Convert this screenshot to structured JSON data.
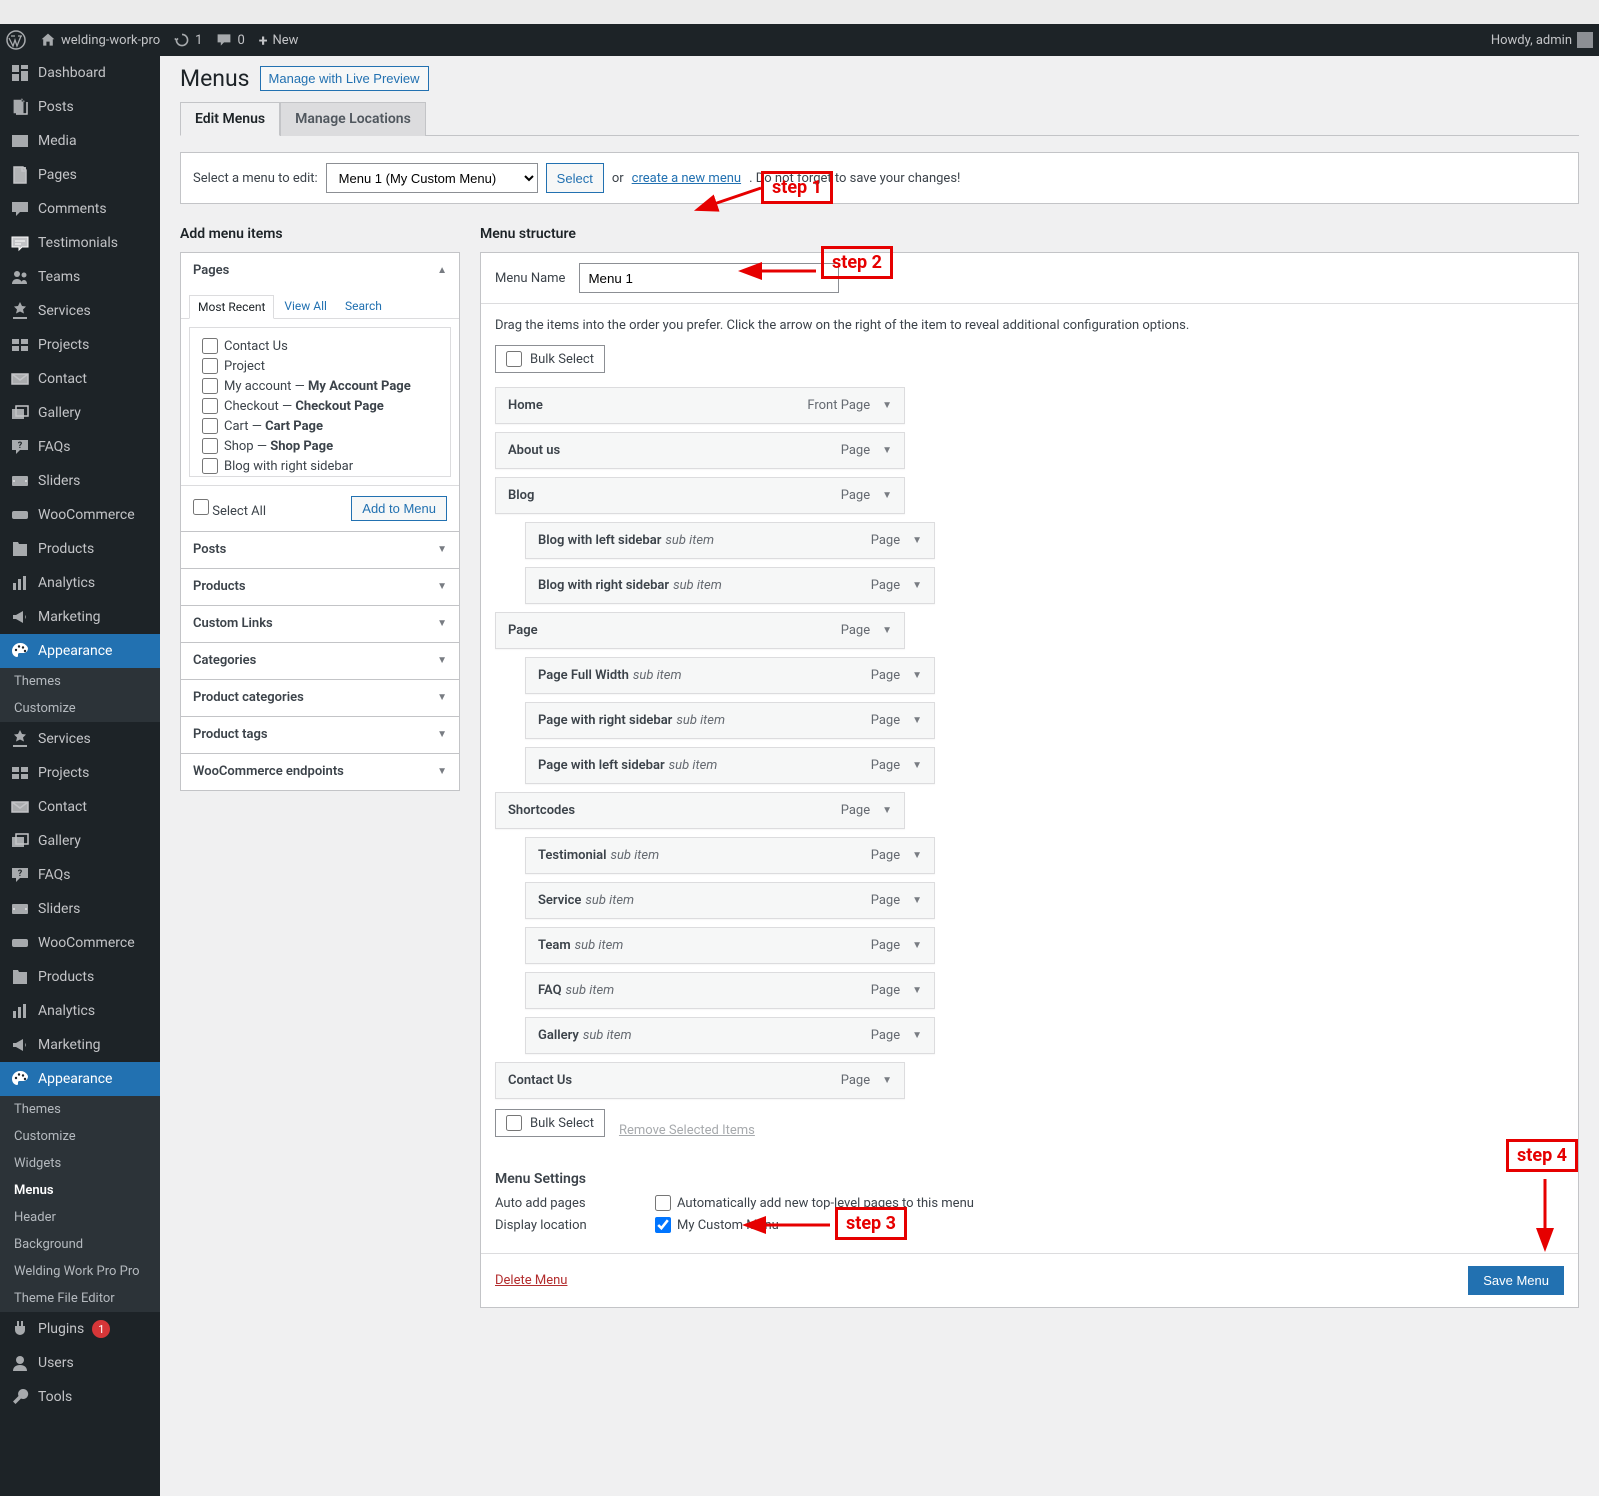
{
  "adminbar": {
    "site_name": "welding-work-pro",
    "updates_count": "1",
    "comments_count": "0",
    "new_label": "New",
    "howdy": "Howdy, admin"
  },
  "sidebar": {
    "items": [
      {
        "icon": "dashboard",
        "label": "Dashboard"
      },
      {
        "icon": "posts",
        "label": "Posts"
      },
      {
        "icon": "media",
        "label": "Media"
      },
      {
        "icon": "pages",
        "label": "Pages"
      },
      {
        "icon": "comments",
        "label": "Comments"
      },
      {
        "icon": "testimonials",
        "label": "Testimonials"
      },
      {
        "icon": "teams",
        "label": "Teams"
      },
      {
        "icon": "services",
        "label": "Services"
      },
      {
        "icon": "projects",
        "label": "Projects"
      },
      {
        "icon": "contact",
        "label": "Contact"
      },
      {
        "icon": "gallery",
        "label": "Gallery"
      },
      {
        "icon": "faqs",
        "label": "FAQs"
      },
      {
        "icon": "sliders",
        "label": "Sliders"
      },
      {
        "icon": "woo",
        "label": "WooCommerce"
      },
      {
        "icon": "products",
        "label": "Products"
      },
      {
        "icon": "analytics",
        "label": "Analytics"
      },
      {
        "icon": "marketing",
        "label": "Marketing"
      },
      {
        "icon": "appearance",
        "label": "Appearance",
        "current": true,
        "sub": [
          "Themes",
          "Customize"
        ]
      },
      {
        "icon": "services",
        "label": "Services"
      },
      {
        "icon": "projects",
        "label": "Projects"
      },
      {
        "icon": "contact",
        "label": "Contact"
      },
      {
        "icon": "gallery",
        "label": "Gallery"
      },
      {
        "icon": "faqs",
        "label": "FAQs"
      },
      {
        "icon": "sliders",
        "label": "Sliders"
      },
      {
        "icon": "woo",
        "label": "WooCommerce"
      },
      {
        "icon": "products",
        "label": "Products"
      },
      {
        "icon": "analytics",
        "label": "Analytics"
      },
      {
        "icon": "marketing",
        "label": "Marketing"
      },
      {
        "icon": "appearance",
        "label": "Appearance",
        "current": true,
        "sub": [
          "Themes",
          "Customize",
          "Widgets",
          "Menus",
          "Header",
          "Background",
          "Welding Work Pro Pro",
          "Theme File Editor"
        ],
        "sub_active": "Menus"
      },
      {
        "icon": "plugins",
        "label": "Plugins",
        "badge": "1"
      },
      {
        "icon": "users",
        "label": "Users"
      },
      {
        "icon": "tools",
        "label": "Tools"
      }
    ]
  },
  "page": {
    "title": "Menus",
    "live_preview": "Manage with Live Preview",
    "tabs": [
      "Edit Menus",
      "Manage Locations"
    ],
    "select_prompt": "Select a menu to edit:",
    "select_value": "Menu 1 (My Custom Menu)",
    "select_btn": "Select",
    "or": "or",
    "create_link": "create a new menu",
    "save_reminder": ". Do not forget to save your changes!"
  },
  "add_items": {
    "heading": "Add menu items",
    "sections": [
      {
        "label": "Pages",
        "open": true
      },
      {
        "label": "Posts"
      },
      {
        "label": "Products"
      },
      {
        "label": "Custom Links"
      },
      {
        "label": "Categories"
      },
      {
        "label": "Product categories"
      },
      {
        "label": "Product tags"
      },
      {
        "label": "WooCommerce endpoints"
      }
    ],
    "subtabs": [
      "Most Recent",
      "View All",
      "Search"
    ],
    "page_list": [
      {
        "label": "Contact Us"
      },
      {
        "label": "Project"
      },
      {
        "label": "My account",
        "suffix": " — ",
        "bold": "My Account Page",
        "wrap": true
      },
      {
        "label": "Checkout",
        "suffix": " — ",
        "bold": "Checkout Page"
      },
      {
        "label": "Cart",
        "suffix": " — ",
        "bold": "Cart Page"
      },
      {
        "label": "Shop",
        "suffix": " — ",
        "bold": "Shop Page"
      },
      {
        "label": "Blog with right sidebar"
      }
    ],
    "select_all": "Select All",
    "add_to_menu": "Add to Menu"
  },
  "structure": {
    "heading": "Menu structure",
    "name_label": "Menu Name",
    "name_value": "Menu 1",
    "helper": "Drag the items into the order you prefer. Click the arrow on the right of the item to reveal additional configuration options.",
    "bulk_select": "Bulk Select",
    "remove_selected": "Remove Selected Items",
    "items": [
      {
        "title": "Home",
        "type": "Front Page",
        "nested": false
      },
      {
        "title": "About us",
        "type": "Page",
        "nested": false
      },
      {
        "title": "Blog",
        "type": "Page",
        "nested": false
      },
      {
        "title": "Blog with left sidebar",
        "type": "Page",
        "nested": true,
        "sub": "sub item"
      },
      {
        "title": "Blog with right sidebar",
        "type": "Page",
        "nested": true,
        "sub": "sub item"
      },
      {
        "title": "Page",
        "type": "Page",
        "nested": false
      },
      {
        "title": "Page Full Width",
        "type": "Page",
        "nested": true,
        "sub": "sub item"
      },
      {
        "title": "Page with right sidebar",
        "type": "Page",
        "nested": true,
        "sub": "sub item"
      },
      {
        "title": "Page with left sidebar",
        "type": "Page",
        "nested": true,
        "sub": "sub item"
      },
      {
        "title": "Shortcodes",
        "type": "Page",
        "nested": false
      },
      {
        "title": "Testimonial",
        "type": "Page",
        "nested": true,
        "sub": "sub item"
      },
      {
        "title": "Service",
        "type": "Page",
        "nested": true,
        "sub": "sub item"
      },
      {
        "title": "Team",
        "type": "Page",
        "nested": true,
        "sub": "sub item"
      },
      {
        "title": "FAQ",
        "type": "Page",
        "nested": true,
        "sub": "sub item"
      },
      {
        "title": "Gallery",
        "type": "Page",
        "nested": true,
        "sub": "sub item"
      },
      {
        "title": "Contact Us",
        "type": "Page",
        "nested": false
      }
    ],
    "settings_heading": "Menu Settings",
    "auto_add_label": "Auto add pages",
    "auto_add_check": "Automatically add new top-level pages to this menu",
    "display_label": "Display location",
    "display_check": "My Custom Menu",
    "delete": "Delete Menu",
    "save": "Save Menu"
  },
  "annotations": {
    "step1": "step 1",
    "step2": "step 2",
    "step3": "step 3",
    "step4": "step 4"
  }
}
